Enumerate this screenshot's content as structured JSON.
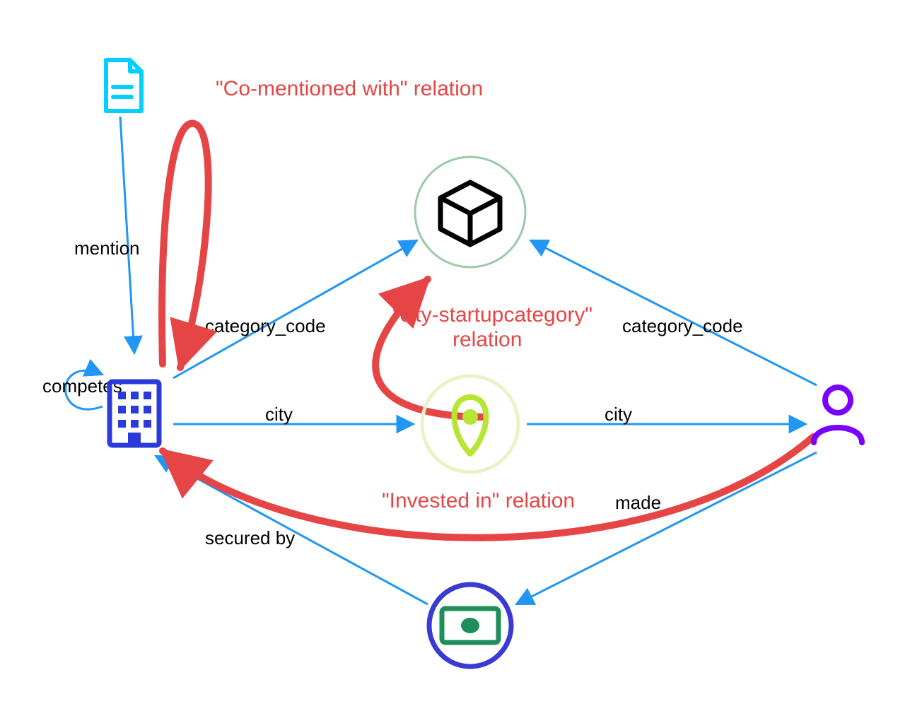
{
  "diagram": {
    "nodes": {
      "document": {
        "type": "document",
        "color": "#00CFFF"
      },
      "company": {
        "type": "building",
        "color": "#2B3BD9"
      },
      "category": {
        "type": "box3d",
        "color": "#000000",
        "ring": "#6BAF7B"
      },
      "city": {
        "type": "location-pin",
        "color": "#B7E534",
        "ring": "#E6F2B8"
      },
      "person": {
        "type": "person",
        "color": "#7A00FF"
      },
      "money": {
        "type": "banknote",
        "color": "#1E8E5A",
        "ring": "#3A3AD4"
      }
    },
    "edges": {
      "mention": {
        "label": "mention",
        "from": "document",
        "to": "company"
      },
      "competes": {
        "label": "competes",
        "from": "company",
        "to": "company"
      },
      "category_left": {
        "label": "category_code",
        "from": "company",
        "to": "category"
      },
      "category_right": {
        "label": "category_code",
        "from": "person",
        "to": "category"
      },
      "city_left": {
        "label": "city",
        "from": "company",
        "to": "city"
      },
      "city_right": {
        "label": "city",
        "from": "city",
        "to": "person"
      },
      "secured_by": {
        "label": "secured by",
        "from": "money",
        "to": "company"
      },
      "made": {
        "label": "made",
        "from": "person",
        "to": "money"
      }
    },
    "annotations": {
      "co_mentioned": {
        "text": "\"Co-mentioned with\" relation"
      },
      "city_category_a": {
        "line1": "\"city-startupcategory\"",
        "line2": "relation"
      },
      "invested_in": {
        "text": "\"Invested in\" relation"
      }
    }
  }
}
